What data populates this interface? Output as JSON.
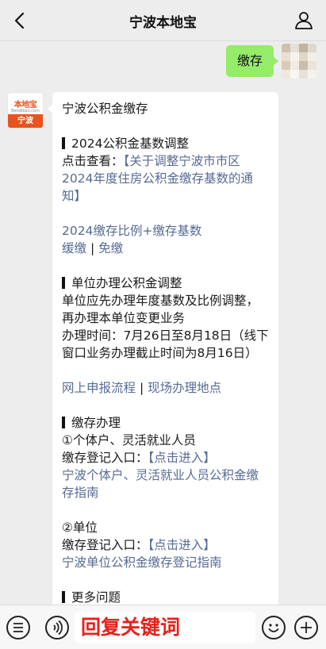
{
  "header": {
    "title": "宁波本地宝"
  },
  "chat": {
    "user_message": "缴存",
    "bot_avatar": {
      "logo_text": "本地宝",
      "logo_sub": "Bendibao.com",
      "city": "宁波"
    },
    "reply": {
      "heading": "宁波公积金缴存",
      "section1": {
        "title": "2024公积金基数调整",
        "prefix": "点击查看：",
        "link": "【关于调整宁波市市区2024年度住房公积金缴存基数的通知】",
        "link2": "2024缴存比例+缴存基数",
        "link3a": "缓缴",
        "sep": " | ",
        "link3b": "免缴"
      },
      "section2": {
        "title": "单位办理公积金调整",
        "line1": "单位应先办理年度基数及比例调整，再办理本单位变更业务",
        "line2": "办理时间：7月26日至8月18日（线下窗口业务办理截止时间为8月16日）",
        "link_a": "网上申报流程",
        "sep": " | ",
        "link_b": "现场办理地点"
      },
      "section3": {
        "title": "缴存办理",
        "item1": "①个体户、灵活就业人员",
        "entry_label": "缴存登记入口：",
        "entry_link": "【点击进入】",
        "guide1": "宁波个体户、灵活就业人员公积金缴存指南",
        "item2": "②单位",
        "entry_label2": "缴存登记入口：",
        "entry_link2": "【点击进入】",
        "guide2": "宁波单位公积金缴存登记指南"
      },
      "section4": {
        "title": "更多问题"
      }
    }
  },
  "input": {
    "overlay_text": "回复关键词"
  },
  "icons": {
    "back": "chevron-left-icon",
    "user": "user-icon",
    "menu": "menu-list-icon",
    "voice": "voice-icon",
    "emoji": "emoji-icon",
    "plus": "plus-icon"
  },
  "colors": {
    "bubble_green": "#95ec69",
    "link_blue": "#576b95",
    "overlay_red": "#e8201b",
    "brand_orange": "#e8541f"
  }
}
